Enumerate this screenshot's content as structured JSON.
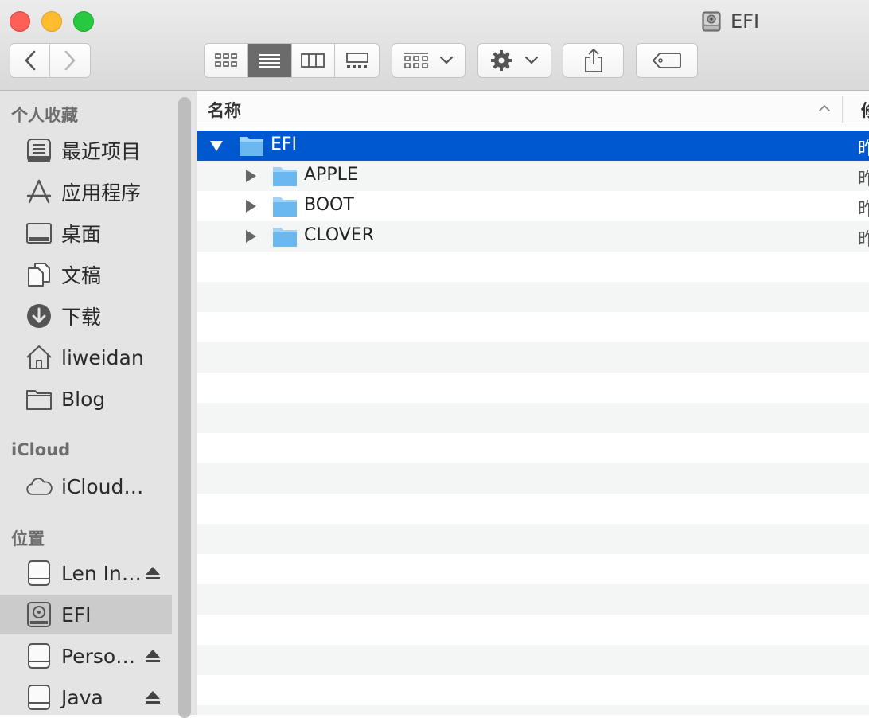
{
  "window": {
    "title": "EFI",
    "title_icon": "drive-icon"
  },
  "toolbar": {
    "back": "chevron-left-icon",
    "forward": "chevron-right-icon",
    "views": [
      "icon-view",
      "list-view",
      "column-view",
      "gallery-view"
    ],
    "active_view": "list-view",
    "group": "group-icon",
    "action": "gear-icon",
    "share": "share-icon",
    "tag": "tag-icon"
  },
  "sidebar": {
    "favorites_header": "个人收藏",
    "favorites": [
      {
        "label": "最近项目",
        "icon": "recents-icon"
      },
      {
        "label": "应用程序",
        "icon": "applications-icon"
      },
      {
        "label": "桌面",
        "icon": "desktop-icon"
      },
      {
        "label": "文稿",
        "icon": "documents-icon"
      },
      {
        "label": "下载",
        "icon": "downloads-icon"
      },
      {
        "label": "liweidan",
        "icon": "home-icon"
      },
      {
        "label": "Blog",
        "icon": "folder-icon"
      }
    ],
    "icloud_header": "iCloud",
    "icloud": [
      {
        "label": "iCloud…",
        "icon": "cloud-icon"
      }
    ],
    "locations_header": "位置",
    "locations": [
      {
        "label": "Len In…",
        "icon": "drive-icon",
        "eject": true
      },
      {
        "label": "EFI",
        "icon": "drive-icon",
        "eject": false,
        "selected": true
      },
      {
        "label": "Perso…",
        "icon": "drive-icon",
        "eject": true
      },
      {
        "label": "Java",
        "icon": "drive-icon",
        "eject": true
      }
    ]
  },
  "list": {
    "name_column": "名称",
    "next_column": "修",
    "rows": [
      {
        "name": "EFI",
        "kind": "昨",
        "expanded": true,
        "level": 0,
        "selected": true
      },
      {
        "name": "APPLE",
        "kind": "昨",
        "expanded": false,
        "level": 1,
        "selected": false
      },
      {
        "name": "BOOT",
        "kind": "昨",
        "expanded": false,
        "level": 1,
        "selected": false
      },
      {
        "name": "CLOVER",
        "kind": "昨",
        "expanded": false,
        "level": 1,
        "selected": false
      }
    ]
  },
  "colors": {
    "selection": "#0058d0",
    "folder": "#6bb8f0",
    "sidebar_bg": "#e4e4e4",
    "stripe": "#f4f5f5"
  }
}
